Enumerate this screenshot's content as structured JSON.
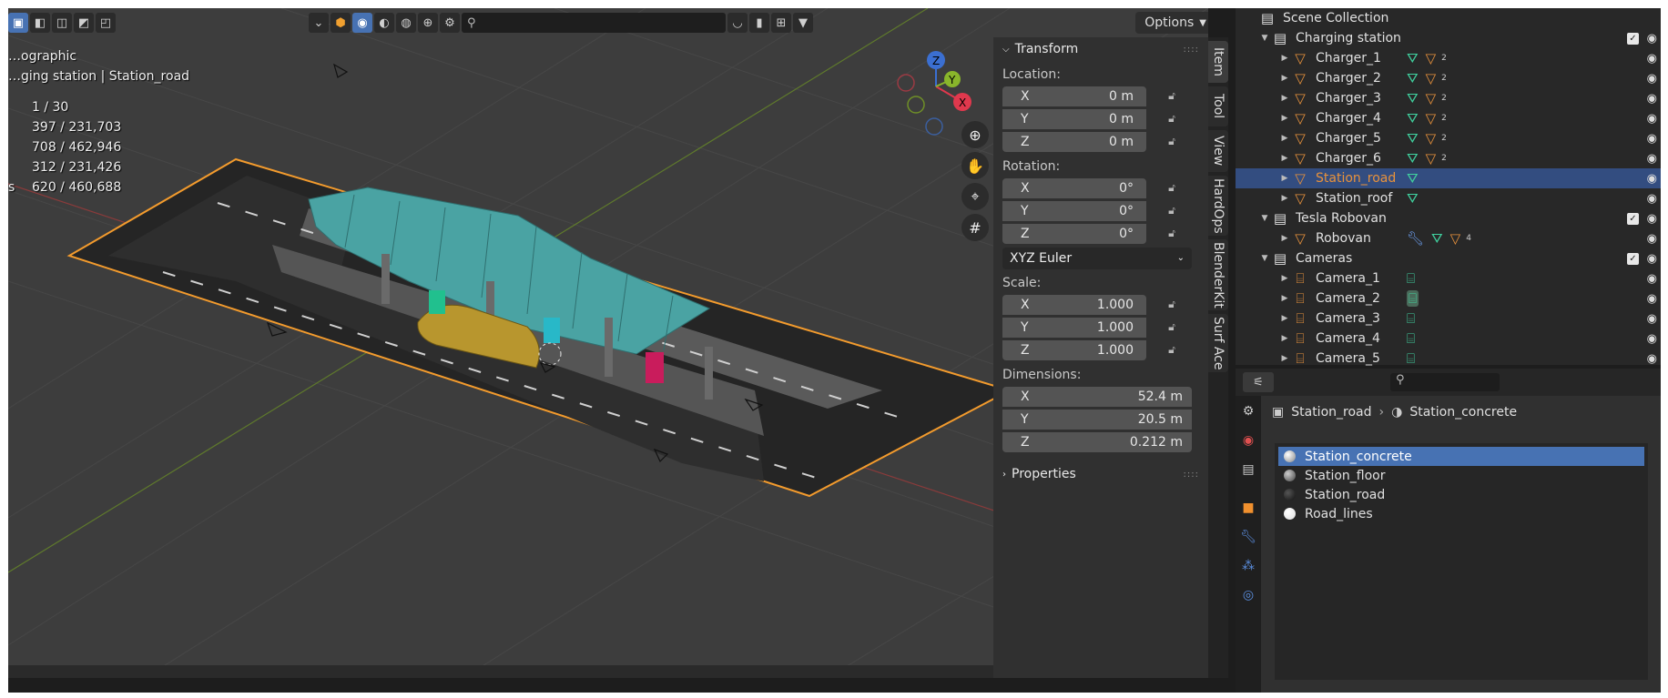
{
  "viewport": {
    "view_mode": "…ographic",
    "context": "…ging station | Station_road",
    "stats": [
      {
        "key": "",
        "value": "1 / 30"
      },
      {
        "key": "",
        "value": "397 / 231,703"
      },
      {
        "key": "",
        "value": "708 / 462,946"
      },
      {
        "key": "",
        "value": "312 / 231,426"
      },
      {
        "key": "s",
        "value": "620 / 460,688"
      }
    ],
    "options_label": "Options",
    "gizmo": {
      "x": "X",
      "y": "Y",
      "z": "Z"
    }
  },
  "transform": {
    "panel_title": "Transform",
    "location_label": "Location:",
    "location": [
      {
        "axis": "X",
        "value": "0 m"
      },
      {
        "axis": "Y",
        "value": "0 m"
      },
      {
        "axis": "Z",
        "value": "0 m"
      }
    ],
    "rotation_label": "Rotation:",
    "rotation": [
      {
        "axis": "X",
        "value": "0°"
      },
      {
        "axis": "Y",
        "value": "0°"
      },
      {
        "axis": "Z",
        "value": "0°"
      }
    ],
    "rotation_mode": "XYZ Euler",
    "scale_label": "Scale:",
    "scale": [
      {
        "axis": "X",
        "value": "1.000"
      },
      {
        "axis": "Y",
        "value": "1.000"
      },
      {
        "axis": "Z",
        "value": "1.000"
      }
    ],
    "dimensions_label": "Dimensions:",
    "dimensions": [
      {
        "axis": "X",
        "value": "52.4 m"
      },
      {
        "axis": "Y",
        "value": "20.5 m"
      },
      {
        "axis": "Z",
        "value": "0.212 m"
      }
    ],
    "properties_label": "Properties"
  },
  "side_tabs": [
    "Item",
    "Tool",
    "View",
    "HardOps",
    "BlenderKit",
    "Surf Ace"
  ],
  "outliner": {
    "root": "Scene Collection",
    "rows": [
      {
        "name": "Charging station",
        "type": "collection",
        "level": 1
      },
      {
        "name": "Charger_1",
        "type": "mesh",
        "level": 2,
        "sub": "2"
      },
      {
        "name": "Charger_2",
        "type": "mesh",
        "level": 2,
        "sub": "2"
      },
      {
        "name": "Charger_3",
        "type": "mesh",
        "level": 2,
        "sub": "2"
      },
      {
        "name": "Charger_4",
        "type": "mesh",
        "level": 2,
        "sub": "2"
      },
      {
        "name": "Charger_5",
        "type": "mesh",
        "level": 2,
        "sub": "2"
      },
      {
        "name": "Charger_6",
        "type": "mesh",
        "level": 2,
        "sub": "2"
      },
      {
        "name": "Station_road",
        "type": "mesh-selected",
        "level": 2,
        "sub": ""
      },
      {
        "name": "Station_roof",
        "type": "mesh-single",
        "level": 2,
        "sub": ""
      },
      {
        "name": "Tesla Robovan",
        "type": "collection",
        "level": 1
      },
      {
        "name": "Robovan",
        "type": "mesh-mod",
        "level": 2,
        "sub": "4"
      },
      {
        "name": "Cameras",
        "type": "collection",
        "level": 1
      },
      {
        "name": "Camera_1",
        "type": "camera",
        "level": 2
      },
      {
        "name": "Camera_2",
        "type": "camera-active",
        "level": 2
      },
      {
        "name": "Camera_3",
        "type": "camera",
        "level": 2
      },
      {
        "name": "Camera_4",
        "type": "camera",
        "level": 2
      },
      {
        "name": "Camera_5",
        "type": "camera",
        "level": 2
      }
    ]
  },
  "properties": {
    "breadcrumb_object": "Station_road",
    "breadcrumb_material": "Station_concrete",
    "materials": [
      {
        "name": "Station_concrete",
        "color": "#bcbcbc"
      },
      {
        "name": "Station_floor",
        "color": "#8a8a8a"
      },
      {
        "name": "Station_road",
        "color": "#2a2a2a"
      },
      {
        "name": "Road_lines",
        "color": "#f2f2f2"
      }
    ]
  },
  "colors": {
    "accent": "#4772b3",
    "selection_outline": "#f39b2d",
    "mesh_icon": "#e8923c",
    "data_icon": "#40d19f"
  }
}
